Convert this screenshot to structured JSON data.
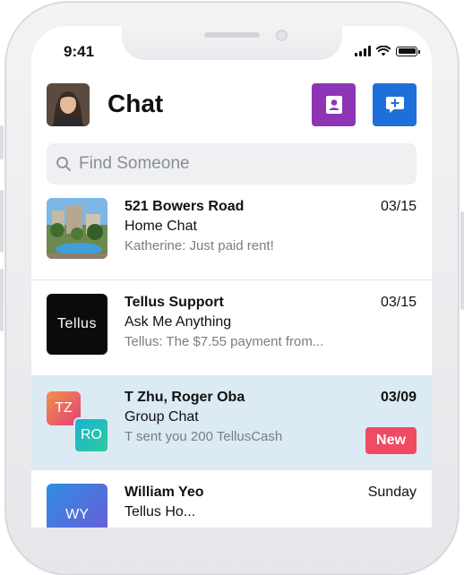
{
  "status": {
    "time": "9:41"
  },
  "header": {
    "title": "Chat"
  },
  "search": {
    "placeholder": "Find Someone"
  },
  "chats": [
    {
      "title": "521 Bowers Road",
      "subtitle": "Home Chat",
      "preview": "Katherine: Just paid rent!",
      "date": "03/15"
    },
    {
      "title": "Tellus Support",
      "subtitle": "Ask Me Anything",
      "preview": "Tellus: The $7.55 payment from...",
      "date": "03/15",
      "logo_text": "Tellus"
    },
    {
      "title": "T Zhu, Roger Oba",
      "subtitle": "Group Chat",
      "preview": "T sent you 200 TellusCash",
      "date": "03/09",
      "badge": "New",
      "initials_a": "TZ",
      "initials_b": "RO"
    },
    {
      "title": "William Yeo",
      "subtitle": "Tellus Ho...",
      "date": "Sunday",
      "initials": "WY"
    }
  ],
  "colors": {
    "contacts_button": "#8e35b6",
    "new_chat_button": "#1f6fd8",
    "selected_row": "#dbeaf3",
    "new_badge": "#ef4b62"
  }
}
